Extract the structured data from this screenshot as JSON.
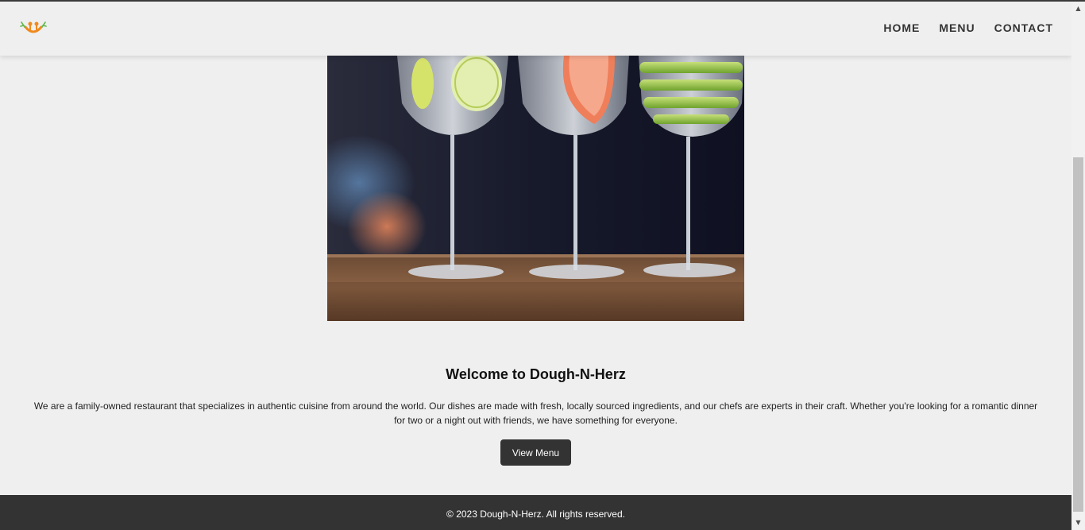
{
  "nav": {
    "logo_icon": "restaurant-logo-icon",
    "links": [
      {
        "label": "HOME"
      },
      {
        "label": "MENU"
      },
      {
        "label": "CONTACT"
      }
    ]
  },
  "hero": {
    "image": "cocktail-glasses-photo"
  },
  "welcome": {
    "title": "Welcome to Dough-N-Herz",
    "text": "We are a family-owned restaurant that specializes in authentic cuisine from around the world. Our dishes are made with fresh, locally sourced ingredients, and our chefs are experts in their craft. Whether you're looking for a romantic dinner for two or a night out with friends, we have something for everyone.",
    "button_label": "View Menu"
  },
  "footer": {
    "text": "© 2023 Dough-N-Herz. All rights reserved."
  },
  "colors": {
    "background": "#efefef",
    "dark": "#333333",
    "logo_orange": "#f08a1c",
    "logo_green": "#5fb84a"
  },
  "scrollbar": {
    "up_icon": "scroll-up-arrow-icon",
    "down_icon": "scroll-down-arrow-icon"
  }
}
